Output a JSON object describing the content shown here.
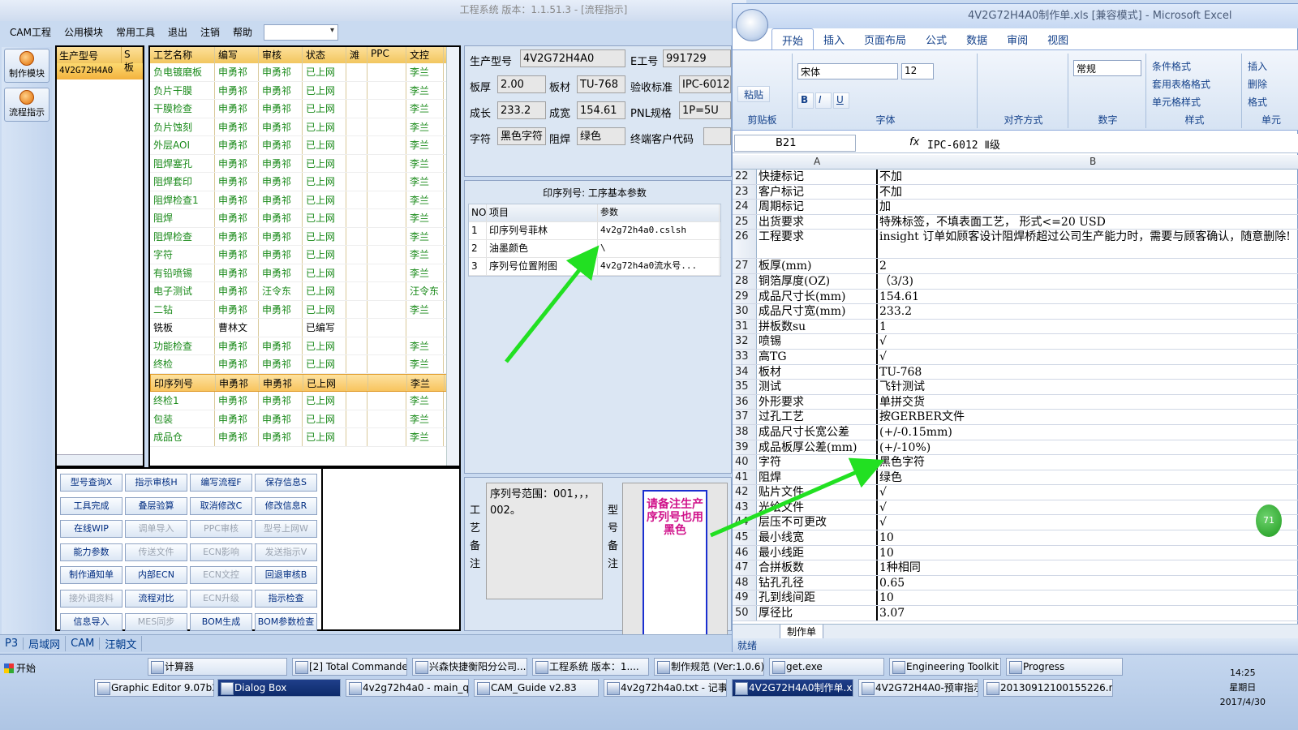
{
  "app": {
    "title": "工程系统  版本：1.1.51.3 - [流程指示]",
    "menu": [
      "CAM工程",
      "公用模块",
      "常用工具",
      "退出",
      "注销",
      "帮助"
    ]
  },
  "sidebar": {
    "buttons": [
      "制作模块",
      "流程指示"
    ]
  },
  "models": {
    "headers": [
      "生产型号",
      "S板"
    ],
    "rows": [
      "4V2G72H4A0"
    ]
  },
  "process": {
    "headers": [
      "工艺名称",
      "编写",
      "审核",
      "状态",
      "滩",
      "PPC",
      "文控"
    ],
    "rows": [
      [
        "负电镀磨板",
        "申勇祁",
        "申勇祁",
        "已上网",
        "",
        "",
        "李兰"
      ],
      [
        "负片干膜",
        "申勇祁",
        "申勇祁",
        "已上网",
        "",
        "",
        "李兰"
      ],
      [
        "干膜检查",
        "申勇祁",
        "申勇祁",
        "已上网",
        "",
        "",
        "李兰"
      ],
      [
        "负片蚀刻",
        "申勇祁",
        "申勇祁",
        "已上网",
        "",
        "",
        "李兰"
      ],
      [
        "外层AOI",
        "申勇祁",
        "申勇祁",
        "已上网",
        "",
        "",
        "李兰"
      ],
      [
        "阻焊塞孔",
        "申勇祁",
        "申勇祁",
        "已上网",
        "",
        "",
        "李兰"
      ],
      [
        "阻焊套印",
        "申勇祁",
        "申勇祁",
        "已上网",
        "",
        "",
        "李兰"
      ],
      [
        "阻焊检查1",
        "申勇祁",
        "申勇祁",
        "已上网",
        "",
        "",
        "李兰"
      ],
      [
        "阻焊",
        "申勇祁",
        "申勇祁",
        "已上网",
        "",
        "",
        "李兰"
      ],
      [
        "阻焊检查",
        "申勇祁",
        "申勇祁",
        "已上网",
        "",
        "",
        "李兰"
      ],
      [
        "字符",
        "申勇祁",
        "申勇祁",
        "已上网",
        "",
        "",
        "李兰"
      ],
      [
        "有铅喷锡",
        "申勇祁",
        "申勇祁",
        "已上网",
        "",
        "",
        "李兰"
      ],
      [
        "电子测试",
        "申勇祁",
        "汪令东",
        "已上网",
        "",
        "",
        "汪令东"
      ],
      [
        "二钻",
        "申勇祁",
        "申勇祁",
        "已上网",
        "",
        "",
        "李兰"
      ],
      [
        "铣板",
        "曹林文",
        "",
        "已编写",
        "",
        "",
        ""
      ],
      [
        "功能检查",
        "申勇祁",
        "申勇祁",
        "已上网",
        "",
        "",
        "李兰"
      ],
      [
        "终检",
        "申勇祁",
        "申勇祁",
        "已上网",
        "",
        "",
        "李兰"
      ],
      [
        "印序列号",
        "申勇祁",
        "申勇祁",
        "已上网",
        "",
        "",
        "李兰"
      ],
      [
        "终检1",
        "申勇祁",
        "申勇祁",
        "已上网",
        "",
        "",
        "李兰"
      ],
      [
        "包装",
        "申勇祁",
        "申勇祁",
        "已上网",
        "",
        "",
        "李兰"
      ],
      [
        "成品仓",
        "申勇祁",
        "申勇祁",
        "已上网",
        "",
        "",
        "李兰"
      ]
    ]
  },
  "buttons": [
    {
      "label": "型号查询X",
      "enabled": true
    },
    {
      "label": "指示审核H",
      "enabled": true
    },
    {
      "label": "编写流程F",
      "enabled": true
    },
    {
      "label": "保存信息S",
      "enabled": true
    },
    {
      "label": "工具完成",
      "enabled": true
    },
    {
      "label": "叠层验算",
      "enabled": true
    },
    {
      "label": "取消修改C",
      "enabled": true
    },
    {
      "label": "修改信息R",
      "enabled": true
    },
    {
      "label": "在线WIP",
      "enabled": true
    },
    {
      "label": "调单导入",
      "enabled": false
    },
    {
      "label": "PPC审核",
      "enabled": false
    },
    {
      "label": "型号上网W",
      "enabled": false
    },
    {
      "label": "能力参数",
      "enabled": true
    },
    {
      "label": "传送文件",
      "enabled": false
    },
    {
      "label": "ECN影响",
      "enabled": false
    },
    {
      "label": "发送指示V",
      "enabled": false
    },
    {
      "label": "制作通知单",
      "enabled": true
    },
    {
      "label": "内部ECN",
      "enabled": true
    },
    {
      "label": "ECN文控",
      "enabled": false
    },
    {
      "label": "回退审核B",
      "enabled": true
    },
    {
      "label": "接外调资料",
      "enabled": false
    },
    {
      "label": "流程对比",
      "enabled": true
    },
    {
      "label": "ECN升级",
      "enabled": false
    },
    {
      "label": "指示检查",
      "enabled": true
    },
    {
      "label": "信息导入",
      "enabled": true
    },
    {
      "label": "MES同步",
      "enabled": false
    },
    {
      "label": "BOM生成",
      "enabled": true
    },
    {
      "label": "BOM参数检查",
      "enabled": true
    }
  ],
  "info": {
    "model_label": "生产型号",
    "model": "4V2G72H4A0",
    "e_label": "E工号",
    "e_no": "991729",
    "thick_label": "板厚",
    "thick": "2.00",
    "mat_label": "板材",
    "mat": "TU-768",
    "std_label": "验收标准",
    "std": "IPC-6012",
    "len_label": "成长",
    "len": "233.2",
    "wid_label": "成宽",
    "wid": "154.61",
    "pnl_label": "PNL规格",
    "pnl": "1P=5U",
    "char_label": "字符",
    "char": "黑色字符",
    "mask_label": "阻焊",
    "mask": "绿色",
    "cust_label": "终端客户代码"
  },
  "params": {
    "title": "印序列号: 工序基本参数",
    "headers": [
      "NO",
      "项目",
      "参数"
    ],
    "rows": [
      [
        "1",
        "印序列号菲林",
        "4v2g72h4a0.cslsh"
      ],
      [
        "2",
        "油墨颜色",
        "\\"
      ],
      [
        "3",
        "序列号位置附图",
        "4v2g72h4a0流水号..."
      ]
    ]
  },
  "remarks": {
    "process_label": "工艺备注",
    "process_text": "序列号范围：001，，，002。",
    "model_label": "型号备注"
  },
  "annotation": "请备注生产序列号也用黑色",
  "status_tabs": [
    "P3",
    "局域网",
    "CAM",
    "汪朝文"
  ],
  "excel": {
    "title": "4V2G72H4A0制作单.xls [兼容模式] - Microsoft Excel",
    "tabs": [
      "开始",
      "插入",
      "页面布局",
      "公式",
      "数据",
      "审阅",
      "视图"
    ],
    "ribbon": {
      "clipboard": "剪贴板",
      "paste": "粘贴",
      "font": "字体",
      "font_name": "宋体",
      "font_size": "12",
      "align": "对齐方式",
      "number": "数字",
      "number_fmt": "常规",
      "style": "样式",
      "cells": "单元",
      "cond": "条件格式",
      "table": "套用表格格式",
      "cellstyle": "单元格样式",
      "insert": "插入",
      "delete": "删除",
      "format": "格式"
    },
    "name_box": "B21",
    "formula": "IPC-6012 Ⅱ级",
    "col_a": "A",
    "col_b": "B",
    "rows": [
      [
        "22",
        "快捷标记",
        "不加"
      ],
      [
        "23",
        "客户标记",
        "不加"
      ],
      [
        "24",
        "周期标记",
        "加"
      ],
      [
        "25",
        "出货要求",
        "特殊标签，不填表面工艺， 形式<=20 USD"
      ],
      [
        "26",
        "工程要求",
        "insight 订单如顾客设计阻焊桥超过公司生产能力时，需要与顾客确认，随意删除!"
      ],
      [
        "27",
        "板厚(mm)",
        "2"
      ],
      [
        "28",
        "铜箔厚度(OZ)",
        "（3/3)"
      ],
      [
        "29",
        "成品尺寸长(mm)",
        "154.61"
      ],
      [
        "30",
        "成品尺寸宽(mm)",
        "233.2"
      ],
      [
        "31",
        "拼板数su",
        "1"
      ],
      [
        "32",
        "喷锡",
        "√"
      ],
      [
        "33",
        "高TG",
        "√"
      ],
      [
        "34",
        "板材",
        "TU-768"
      ],
      [
        "35",
        "测试",
        "飞针测试"
      ],
      [
        "36",
        "外形要求",
        "单拼交货"
      ],
      [
        "37",
        "过孔工艺",
        "按GERBER文件"
      ],
      [
        "38",
        "成品尺寸长宽公差",
        "(+/-0.15mm)"
      ],
      [
        "39",
        "成品板厚公差(mm)",
        "(+/-10%)"
      ],
      [
        "40",
        "字符",
        "黑色字符"
      ],
      [
        "41",
        "阻焊",
        "绿色"
      ],
      [
        "42",
        "贴片文件",
        "√"
      ],
      [
        "43",
        "光绘文件",
        "√"
      ],
      [
        "44",
        "层压不可更改",
        "√"
      ],
      [
        "45",
        "最小线宽",
        "10"
      ],
      [
        "46",
        "最小线距",
        "10"
      ],
      [
        "47",
        "合拼板数",
        "1种相同"
      ],
      [
        "48",
        "钻孔孔径",
        "0.65"
      ],
      [
        "49",
        "孔到线间距",
        "10"
      ],
      [
        "50",
        "厚径比",
        "3.07"
      ]
    ],
    "sheet": "制作单",
    "status": "就绪"
  },
  "badge": "71",
  "taskbar": {
    "start": "开始",
    "row1": [
      "计算器",
      "[2] Total Commander ...",
      "兴森快捷衡阳分公司...",
      "工程系统  版本：1....",
      "制作规范 (Ver:1.0.6)",
      "get.exe",
      "Engineering Toolkit 9....",
      "Progress"
    ],
    "row2": [
      "Graphic Editor 9.07b2 (0...",
      "Dialog Box",
      "4v2g72h4a0 - main_qa",
      "CAM_Guide v2.83",
      "4v2g72h4a0.txt - 记事本",
      "4V2G72H4A0制作单.x...",
      "4V2G72H4A0-预审指示...",
      "20130912100155226.rtf..."
    ],
    "time": "14:25",
    "weekday": "星期日",
    "date": "2017/4/30"
  },
  "colors": {
    "arrow": "#22e022",
    "process_text": "#1a8a1a",
    "annotation_text": "#d0128a",
    "annotation_border": "#1a2fd0"
  }
}
